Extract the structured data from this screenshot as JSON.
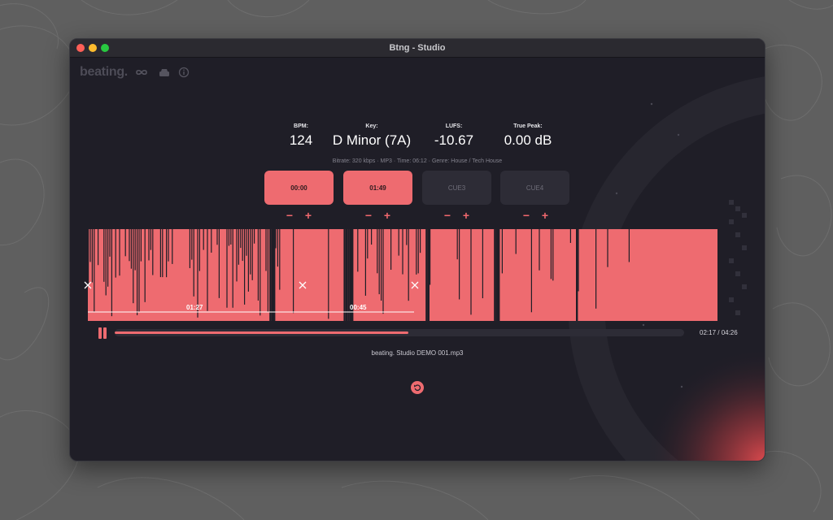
{
  "window": {
    "title": "Btng - Studio"
  },
  "app": {
    "logo": "beating.",
    "nav_icons": [
      "infinity-icon",
      "cloud-icon",
      "info-icon"
    ]
  },
  "stats": [
    {
      "label": "BPM:",
      "value": "124"
    },
    {
      "label": "Key:",
      "value": "D Minor (7A)"
    },
    {
      "label": "LUFS:",
      "value": "-10.67"
    },
    {
      "label": "True Peak:",
      "value": "0.00 dB"
    }
  ],
  "meta": "Bitrate: 320 kbps · MP3 · Time: 06:12 · Genre: House / Tech House",
  "cues": [
    {
      "label": "00:00",
      "set": true
    },
    {
      "label": "01:49",
      "set": true
    },
    {
      "label": "CUE3",
      "set": false
    },
    {
      "label": "CUE4",
      "set": false
    }
  ],
  "cue_controls": {
    "minus": "−",
    "plus": "+"
  },
  "waveform": {
    "markers": [
      "01:27",
      "00:45"
    ]
  },
  "player": {
    "progress_fraction": 0.515,
    "time": "02:17 / 04:26",
    "filename": "beating. Studio DEMO 001.mp3"
  },
  "colors": {
    "accent": "#ee6b70",
    "background": "#1f1e27",
    "panel": "#2d2c36"
  }
}
